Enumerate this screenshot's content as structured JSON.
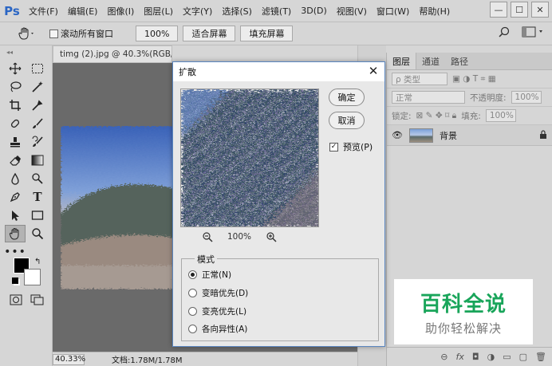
{
  "app": {
    "logo": "Ps"
  },
  "menu": [
    "文件(F)",
    "编辑(E)",
    "图像(I)",
    "图层(L)",
    "文字(Y)",
    "选择(S)",
    "滤镜(T)",
    "3D(D)",
    "视图(V)",
    "窗口(W)",
    "帮助(H)"
  ],
  "window_controls": {
    "minimize": "—",
    "maximize": "☐",
    "close": "✕"
  },
  "options": {
    "scroll_all_label": "滚动所有窗口",
    "zoom_100": "100%",
    "fit_screen": "适合屏幕",
    "fill_screen": "填充屏幕"
  },
  "document": {
    "tab_title": "timg (2).jpg @ 40.3%(RGB/8#) *",
    "zoom_status": "40.33%",
    "doc_info": "文档:1.78M/1.78M"
  },
  "layers_panel": {
    "tabs": [
      "图层",
      "通道",
      "路径"
    ],
    "filter_kind": "ρ 类型",
    "blend_mode": "正常",
    "opacity_label": "不透明度:",
    "opacity_value": "100%",
    "lock_label": "锁定:",
    "fill_label": "填充:",
    "fill_value": "100%",
    "layer_name": "背景"
  },
  "dialog": {
    "title": "扩散",
    "ok": "确定",
    "cancel": "取消",
    "preview_label": "预览(P)",
    "preview_checked": true,
    "zoom_value": "100%",
    "mode_legend": "模式",
    "modes": [
      {
        "label": "正常(N)",
        "selected": true
      },
      {
        "label": "变暗优先(D)",
        "selected": false
      },
      {
        "label": "变亮优先(L)",
        "selected": false
      },
      {
        "label": "各向异性(A)",
        "selected": false
      }
    ]
  },
  "watermark": {
    "title": "百科全说",
    "subtitle": "助你轻松解决"
  },
  "colors": {
    "ps_blue": "#2b66c4",
    "watermark_green": "#19a55a",
    "dialog_border": "#5a86c0"
  },
  "icons": [
    "hand-tool-icon",
    "move-tool-icon",
    "marquee-tool-icon",
    "lasso-tool-icon",
    "magic-wand-icon",
    "crop-tool-icon",
    "eyedropper-icon",
    "healing-brush-icon",
    "brush-tool-icon",
    "stamp-tool-icon",
    "history-brush-icon",
    "eraser-icon",
    "gradient-icon",
    "blur-icon",
    "dodge-icon",
    "pen-tool-icon",
    "type-tool-icon",
    "path-select-icon",
    "shape-tool-icon",
    "zoom-tool-icon",
    "zoom-out-icon",
    "zoom-in-icon",
    "eye-icon",
    "lock-icon"
  ]
}
